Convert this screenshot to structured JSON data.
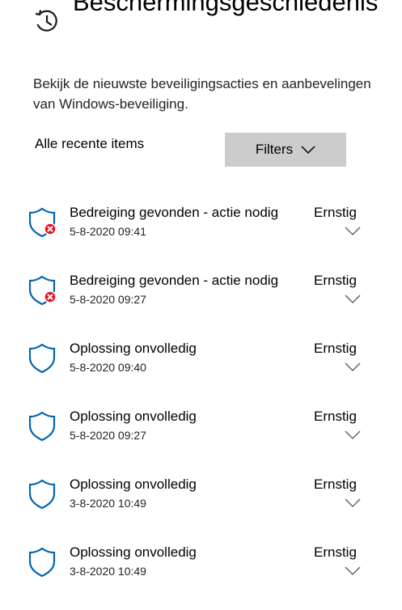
{
  "page": {
    "title": "Beschermingsgeschiedenis",
    "description": "Bekijk de nieuwste beveiligingsacties en aanbevelingen van Windows-beveiliging."
  },
  "filter": {
    "label": "Alle recente items",
    "button_label": "Filters"
  },
  "items": [
    {
      "title": "Bedreiging gevonden - actie nodig",
      "date": "5-8-2020 09:41",
      "severity": "Ernstig",
      "icon": "shield-error-icon"
    },
    {
      "title": "Bedreiging gevonden - actie nodig",
      "date": "5-8-2020 09:27",
      "severity": "Ernstig",
      "icon": "shield-error-icon"
    },
    {
      "title": "Oplossing onvolledig",
      "date": "5-8-2020 09:40",
      "severity": "Ernstig",
      "icon": "shield-icon"
    },
    {
      "title": "Oplossing onvolledig",
      "date": "5-8-2020 09:27",
      "severity": "Ernstig",
      "icon": "shield-icon"
    },
    {
      "title": "Oplossing onvolledig",
      "date": "3-8-2020 10:49",
      "severity": "Ernstig",
      "icon": "shield-icon"
    },
    {
      "title": "Oplossing onvolledig",
      "date": "3-8-2020 10:49",
      "severity": "Ernstig",
      "icon": "shield-icon"
    }
  ],
  "colors": {
    "shield": "#0063b1",
    "error": "#e81123",
    "button_bg": "#cccccc"
  }
}
